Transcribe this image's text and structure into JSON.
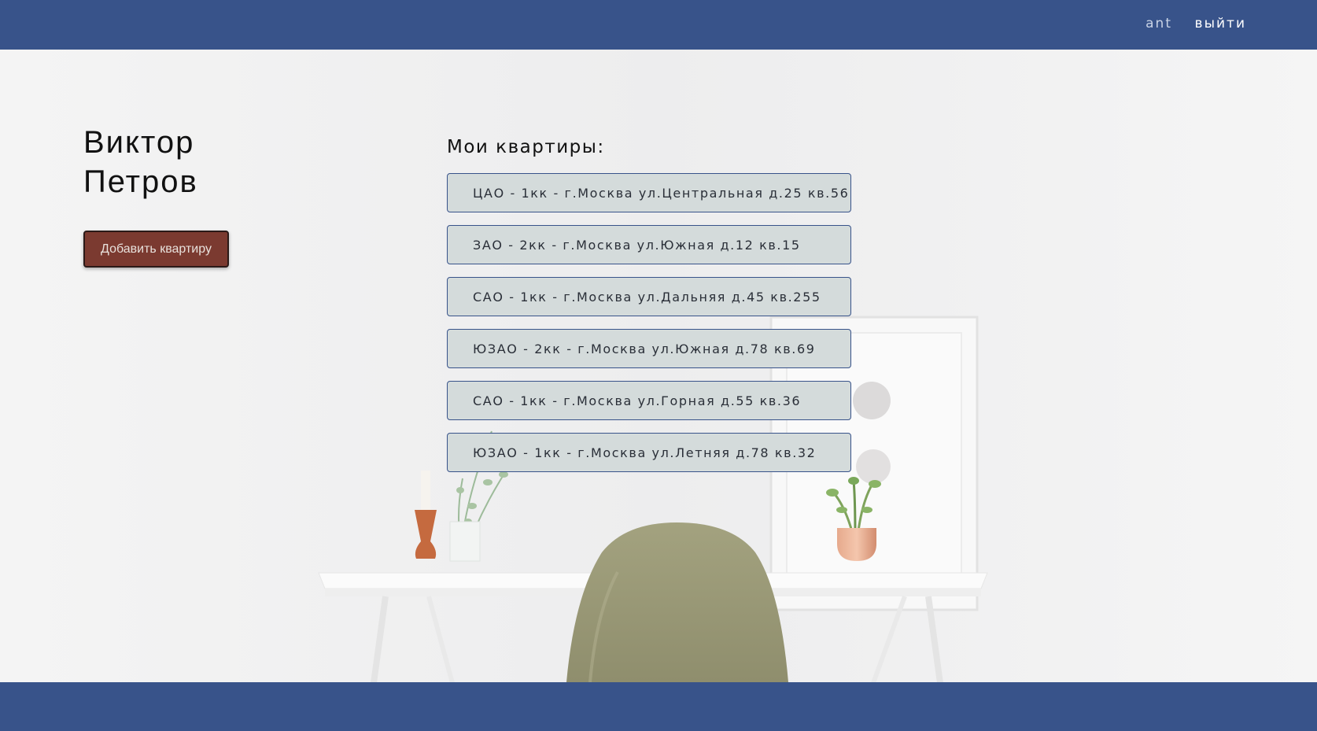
{
  "header": {
    "username": "ant",
    "logout_label": "выйти"
  },
  "profile": {
    "name": "Виктор Петров",
    "add_button_label": "Добавить квартиру"
  },
  "apartments": {
    "heading": "Мои квартиры:",
    "items": [
      "ЦАО - 1кк - г.Москва ул.Центральная д.25 кв.56",
      "ЗАО - 2кк - г.Москва ул.Южная д.12 кв.15",
      "САО - 1кк - г.Москва ул.Дальняя д.45 кв.255",
      "ЮЗАО - 2кк - г.Москва ул.Южная д.78 кв.69",
      "САО - 1кк - г.Москва ул.Горная д.55 кв.36",
      "ЮЗАО - 1кк - г.Москва ул.Летняя д.78 кв.32"
    ]
  },
  "colors": {
    "header_bg": "#38538a",
    "button_bg": "#7b3a30",
    "list_item_bg": "#d4dbdb"
  }
}
